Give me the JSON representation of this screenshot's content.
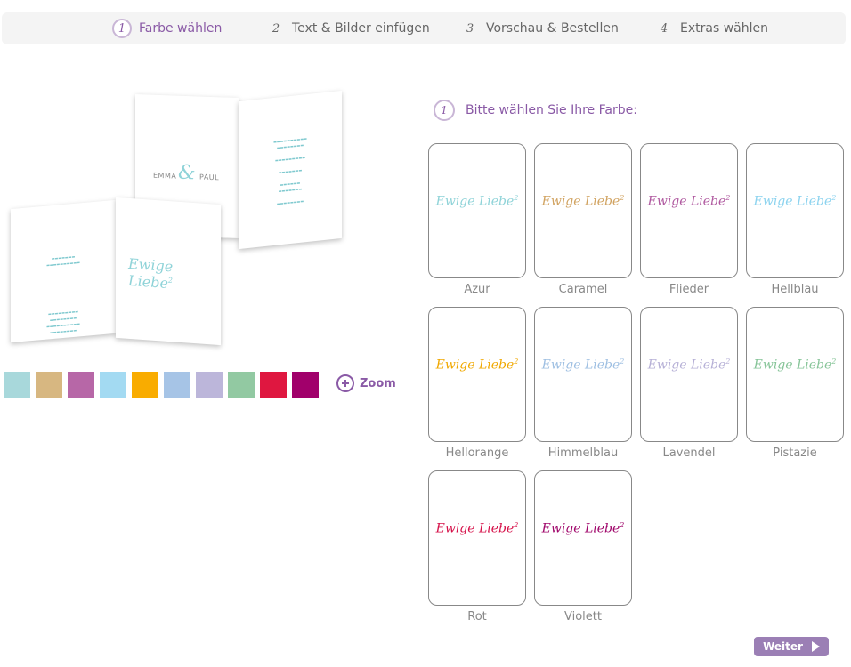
{
  "steps": [
    {
      "num": "1",
      "label": "Farbe wählen",
      "active": true
    },
    {
      "num": "2",
      "label": "Text & Bilder einfügen",
      "active": false
    },
    {
      "num": "3",
      "label": "Vorschau & Bestellen",
      "active": false
    },
    {
      "num": "4",
      "label": "Extras wählen",
      "active": false
    }
  ],
  "preview": {
    "names_left": "EMMA",
    "names_right": "PAUL",
    "ampersand": "&",
    "logo_text": "Ewige Liebe",
    "logo_sup": "2"
  },
  "swatches": [
    "#a8d8db",
    "#d7b781",
    "#b767a7",
    "#a3daf2",
    "#f9ac00",
    "#a6c4e6",
    "#bcb6da",
    "#92c9a2",
    "#df1740",
    "#a1006b"
  ],
  "zoom_label": "Zoom",
  "heading": {
    "num": "1",
    "text": "Bitte wählen Sie Ihre Farbe:"
  },
  "colors": [
    {
      "name": "Azur",
      "color": "#8fd3d8"
    },
    {
      "name": "Caramel",
      "color": "#d1a361"
    },
    {
      "name": "Flieder",
      "color": "#b05aa0"
    },
    {
      "name": "Hellblau",
      "color": "#8cd3ef"
    },
    {
      "name": "Hellorange",
      "color": "#f0a800"
    },
    {
      "name": "Himmelblau",
      "color": "#9ebfe2"
    },
    {
      "name": "Lavendel",
      "color": "#b6b0d6"
    },
    {
      "name": "Pistazie",
      "color": "#86c498"
    },
    {
      "name": "Rot",
      "color": "#d6124a"
    },
    {
      "name": "Violett",
      "color": "#a0076b"
    }
  ],
  "weiter_label": "Weiter"
}
